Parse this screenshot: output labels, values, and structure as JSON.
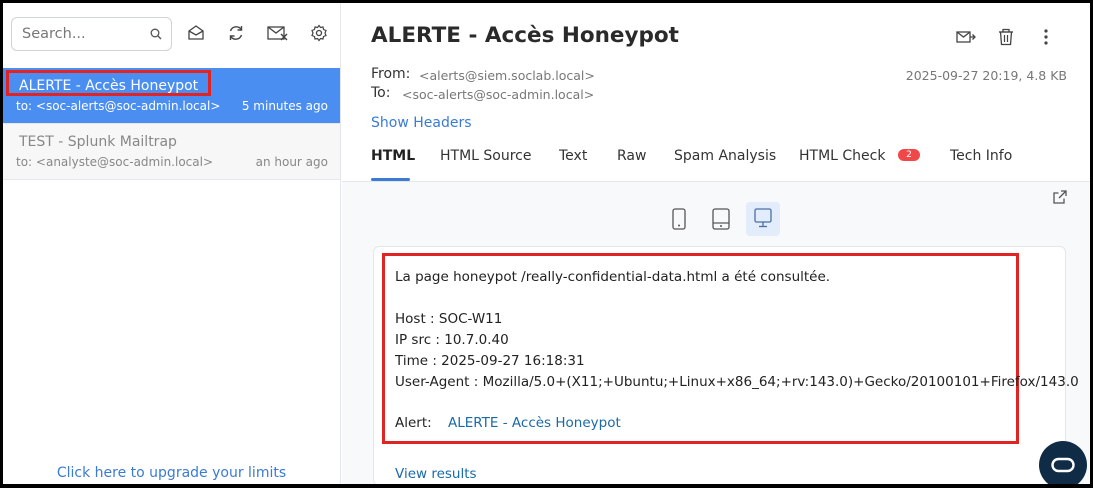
{
  "sidebar": {
    "search": {
      "placeholder": "Search..."
    },
    "toolbar_icons": [
      "search-icon",
      "mark-read-icon",
      "refresh-icon",
      "delete-all-icon",
      "settings-icon"
    ],
    "messages": [
      {
        "subject": "ALERTE - Accès Honeypot",
        "to": "to: <soc-alerts@soc-admin.local>",
        "time": "5 minutes ago",
        "selected": true
      },
      {
        "subject": "TEST - Splunk Mailtrap",
        "to": "to: <analyste@soc-admin.local>",
        "time": "an hour ago",
        "selected": false
      }
    ],
    "upgrade_link": "Click here to upgrade your limits"
  },
  "message": {
    "title": "ALERTE - Accès Honeypot",
    "from_label": "From:",
    "from_value": "<alerts@siem.soclab.local>",
    "to_label": "To:",
    "to_value": "<soc-alerts@soc-admin.local>",
    "meta": "2025-09-27 20:19, 4.8 KB",
    "show_headers": "Show Headers",
    "header_icons": [
      "forward-icon",
      "trash-icon",
      "more-vert-icon"
    ],
    "tabs": [
      {
        "label": "HTML",
        "active": true
      },
      {
        "label": "HTML Source"
      },
      {
        "label": "Text"
      },
      {
        "label": "Raw"
      },
      {
        "label": "Spam Analysis"
      },
      {
        "label": "HTML Check",
        "badge": "2"
      },
      {
        "label": "Tech Info"
      }
    ],
    "device_modes": [
      "mobile-icon",
      "tablet-icon",
      "desktop-icon"
    ],
    "selected_device": "desktop-icon",
    "body": {
      "line1": "La page honeypot /really-confidential-data.html a été consultée.",
      "host": "Host : SOC-W11",
      "ip": "IP src : 10.7.0.40",
      "time": "Time : 2025-09-27 16:18:31",
      "ua": "User-Agent : Mozilla/5.0+(X11;+Ubuntu;+Linux+x86_64;+rv:143.0)+Gecko/20100101+Firefox/143.0",
      "alert_label": "Alert:",
      "alert_link": "ALERTE - Accès Honeypot",
      "view_results": "View results"
    }
  },
  "colors": {
    "accent": "#4a8ef2",
    "link": "#3a7bd5",
    "highlight_box": "#e02424",
    "badge": "#f04848",
    "fab": "#0f2b46"
  }
}
